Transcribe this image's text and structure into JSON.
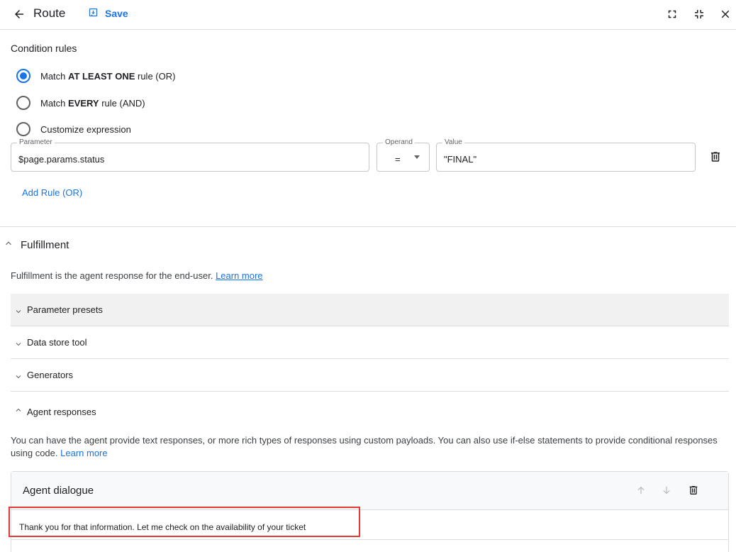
{
  "header": {
    "title": "Route",
    "save_label": "Save"
  },
  "condition_rules": {
    "label": "Condition rules",
    "options": [
      {
        "prefix": "Match ",
        "bold": "AT LEAST ONE",
        "suffix": " rule (OR)",
        "checked": true
      },
      {
        "prefix": "Match ",
        "bold": "EVERY",
        "suffix": " rule (AND)",
        "checked": false
      },
      {
        "prefix": "Customize expression",
        "bold": "",
        "suffix": "",
        "checked": false
      }
    ],
    "rule": {
      "parameter_label": "Parameter",
      "parameter_value": "$page.params.status",
      "operand_label": "Operand",
      "operand_value": "=",
      "value_label": "Value",
      "value_value": "\"FINAL\""
    },
    "add_rule_label": "Add Rule (OR)"
  },
  "fulfillment": {
    "title": "Fulfillment",
    "description": "Fulfillment is the agent response for the end-user.",
    "learn_more": "Learn more",
    "sections": [
      {
        "label": "Parameter presets",
        "expanded": false
      },
      {
        "label": "Data store tool",
        "expanded": false
      },
      {
        "label": "Generators",
        "expanded": false
      },
      {
        "label": "Agent responses",
        "expanded": true
      }
    ],
    "agent_responses_description": "You can have the agent provide text responses, or more rich types of responses using custom payloads. You can also use if-else statements to provide conditional responses using code.",
    "agent_responses_learn_more": "Learn more",
    "dialogue": {
      "title": "Agent dialogue",
      "response_text": "Thank you for that information. Let me check on the availability of your ticket"
    }
  },
  "colors": {
    "accent": "#1a73e8",
    "highlight": "#e53935"
  }
}
